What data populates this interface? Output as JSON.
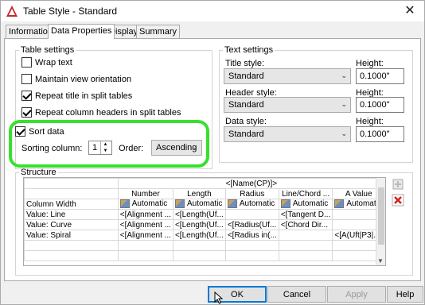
{
  "window": {
    "title": "Table Style - Standard",
    "close_glyph": "✕"
  },
  "tabs": [
    {
      "label": "Information"
    },
    {
      "label": "Data Properties"
    },
    {
      "label": "Display"
    },
    {
      "label": "Summary"
    }
  ],
  "table_settings": {
    "legend": "Table settings",
    "wrap_text": {
      "label": "Wrap text",
      "checked": false
    },
    "maintain_view": {
      "label": "Maintain view orientation",
      "checked": false
    },
    "repeat_title": {
      "label": "Repeat title in split tables",
      "checked": true
    },
    "repeat_headers": {
      "label": "Repeat column headers in split tables",
      "checked": true
    }
  },
  "sort": {
    "label": "Sort data",
    "checked": true,
    "column_label": "Sorting column:",
    "column_value": "1",
    "order_label": "Order:",
    "order_value": "Ascending",
    "highlight_color": "#38e02e"
  },
  "text_settings": {
    "legend": "Text settings",
    "title_style_label": "Title style:",
    "title_style_value": "Standard",
    "header_style_label": "Header style:",
    "header_style_value": "Standard",
    "data_style_label": "Data style:",
    "data_style_value": "Standard",
    "height_label": "Height:",
    "title_height": "0.1000\"",
    "header_height": "0.1000\"",
    "data_height": "0.1000\""
  },
  "structure": {
    "legend": "Structure",
    "title_cell": "<[Name(CP)]>",
    "column_headers": [
      "Number",
      "Length",
      "Radius",
      "Line/Chord ...",
      "A Value"
    ],
    "width_label": "Column Width",
    "auto_label": "Automatic",
    "rows": [
      {
        "label": "Value: Line",
        "cells": [
          "<[Alignment ...",
          "<[Length(Uf...",
          "",
          "<[Tangent D...",
          ""
        ]
      },
      {
        "label": "Value: Curve",
        "cells": [
          "<[Alignment ...",
          "<[Length(Uf...",
          "<[Radius(Uf...",
          "<[Chord Dir...",
          ""
        ]
      },
      {
        "label": "Value: Spiral",
        "cells": [
          "<[Alignment ...",
          "<[Length(Uf...",
          "<[Radius in(...",
          "",
          "<[A(Uft|P3|..."
        ]
      }
    ]
  },
  "buttons": {
    "ok": "OK",
    "cancel": "Cancel",
    "apply": "Apply",
    "help": "Help"
  }
}
